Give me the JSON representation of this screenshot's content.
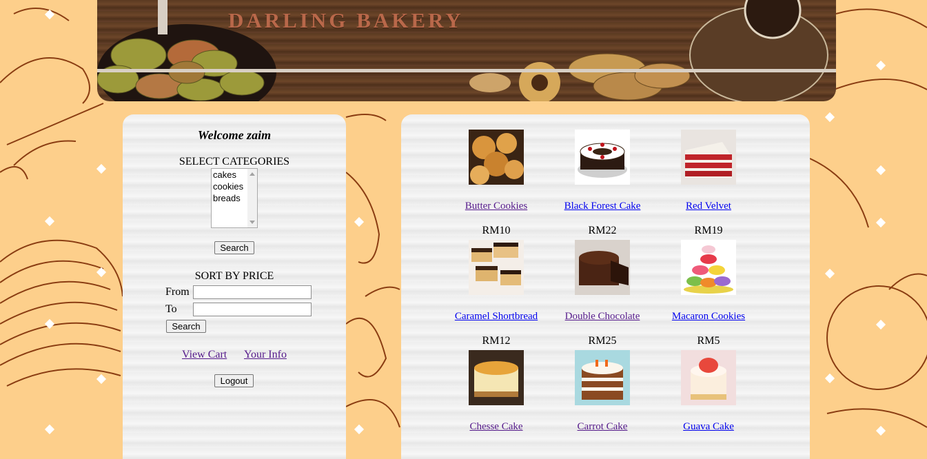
{
  "header": {
    "brand": "DARLING BAKERY"
  },
  "sidebar": {
    "welcome": "Welcome zaim",
    "categories_title": "SELECT CATEGORIES",
    "categories": [
      "cakes",
      "cookies",
      "breads"
    ],
    "search_label": "Search",
    "sort_title": "SORT BY PRICE",
    "from_label": "From",
    "to_label": "To",
    "search2_label": "Search",
    "view_cart": "View Cart",
    "your_info": "Your Info",
    "logout_label": "Logout"
  },
  "products": [
    {
      "name": "Butter Cookies",
      "price": "RM10",
      "image": "butter-cookies-photo",
      "visited": true
    },
    {
      "name": "Black Forest Cake",
      "price": "RM22",
      "image": "black-forest-cake-photo",
      "visited": false
    },
    {
      "name": "Red Velvet",
      "price": "RM19",
      "image": "red-velvet-photo",
      "visited": false
    },
    {
      "name": "Caramel Shortbread",
      "price": "RM12",
      "image": "caramel-shortbread-photo",
      "visited": false
    },
    {
      "name": "Double Chocolate",
      "price": "RM25",
      "image": "double-chocolate-photo",
      "visited": true
    },
    {
      "name": "Macaron Cookies",
      "price": "RM5",
      "image": "macaron-cookies-photo",
      "visited": false
    },
    {
      "name": "Chesse Cake",
      "image": "cheese-cake-photo",
      "visited": true
    },
    {
      "name": "Carrot Cake",
      "image": "carrot-cake-photo",
      "visited": true
    },
    {
      "name": "Guava Cake",
      "image": "guava-cake-photo",
      "visited": false
    }
  ],
  "colors": {
    "background": "#fdcf8b",
    "sketch": "#8a3d12",
    "link_visited": "#551a8b",
    "link": "#0000ee"
  }
}
